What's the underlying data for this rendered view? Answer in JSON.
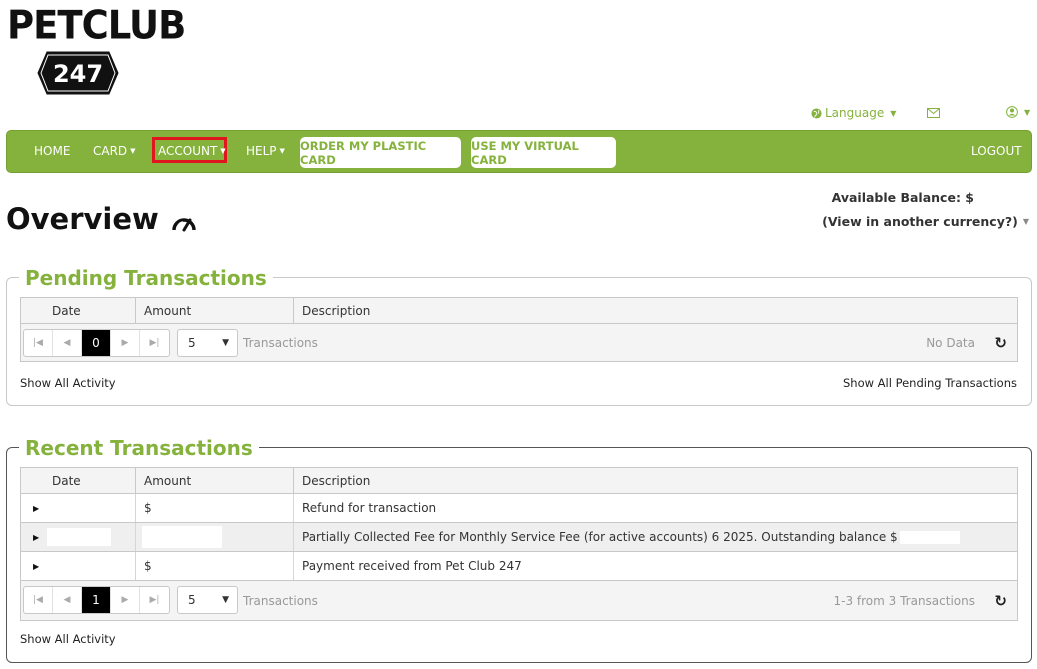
{
  "logo": {
    "text": "PETCLUB",
    "number": "247"
  },
  "utility": {
    "language_label": "Language",
    "icons": [
      "globe-icon",
      "envelope-icon",
      "user-icon"
    ]
  },
  "nav": {
    "home": "HOME",
    "card": "CARD",
    "account": "ACCOUNT",
    "help": "HELP",
    "order_plastic": "ORDER MY PLASTIC CARD",
    "virtual_card": "USE MY VIRTUAL CARD",
    "logout": "LOGOUT"
  },
  "balance": {
    "label": "Available Balance: $",
    "currency_link": "(View in another currency?)"
  },
  "page_title": "Overview",
  "pending": {
    "title": "Pending Transactions",
    "columns": [
      "Date",
      "Amount",
      "Description"
    ],
    "pager": {
      "current_page": "0",
      "page_size": "5",
      "label": "Transactions",
      "info": "No Data"
    },
    "show_all_activity": "Show All Activity",
    "show_all_pending": "Show All Pending Transactions"
  },
  "recent": {
    "title": "Recent Transactions",
    "columns": [
      "Date",
      "Amount",
      "Description"
    ],
    "rows": [
      {
        "date": "",
        "amount": "$",
        "description": "Refund for transaction"
      },
      {
        "date": "",
        "amount": "",
        "description": "Partially Collected Fee for Monthly Service Fee (for active accounts) 6 2025. Outstanding balance $"
      },
      {
        "date": "",
        "amount": "$",
        "description": "Payment received from Pet Club 247"
      }
    ],
    "pager": {
      "current_page": "1",
      "page_size": "5",
      "label": "Transactions",
      "info": "1-3 from 3 Transactions"
    },
    "show_all_activity": "Show All Activity"
  },
  "colors": {
    "brand_green": "#85b23c",
    "highlight_red": "#e0161f"
  }
}
